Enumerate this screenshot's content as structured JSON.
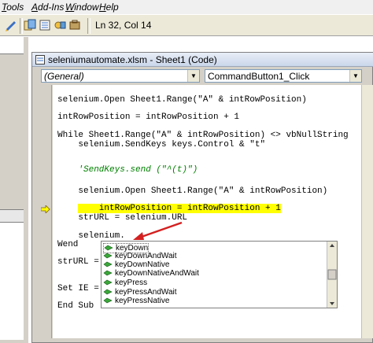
{
  "menubar": {
    "items": [
      {
        "label": "Tools",
        "u": "T",
        "rest": "ools"
      },
      {
        "label": "Add-Ins",
        "u": "A",
        "rest": "dd-Ins"
      },
      {
        "label": "Window",
        "u": "W",
        "rest": "indow"
      },
      {
        "label": "Help",
        "u": "H",
        "rest": "elp"
      }
    ]
  },
  "toolbar": {
    "status": "Ln 32, Col 14"
  },
  "codewindow": {
    "title": "seleniumautomate.xlsm - Sheet1 (Code)",
    "object_combo": "(General)",
    "procedure_combo": "CommandButton1_Click"
  },
  "code": {
    "lines": [
      "selenium.Open Sheet1.Range(\"A\" & intRowPosition)",
      "intRowPosition = intRowPosition + 1",
      "While Sheet1.Range(\"A\" & intRowPosition) <> vbNullString",
      "    selenium.SendKeys keys.Control & \"t\"",
      "    'SendKeys.send (\"^(t)\")",
      "    selenium.Open Sheet1.Range(\"A\" & intRowPosition)",
      "    intRowPosition = intRowPosition + 1",
      "    strURL = selenium.URL",
      "    selenium.",
      "Wend",
      "strURL = se",
      "Set IE = No",
      "End Sub"
    ]
  },
  "autocomplete": {
    "items": [
      "keyDown",
      "keyDownAndWait",
      "keyDownNative",
      "keyDownNativeAndWait",
      "keyPress",
      "keyPressAndWait",
      "keyPressNative"
    ]
  },
  "colors": {
    "highlight": "#ffff00",
    "comment": "#008000",
    "arrow": "#d42020"
  }
}
